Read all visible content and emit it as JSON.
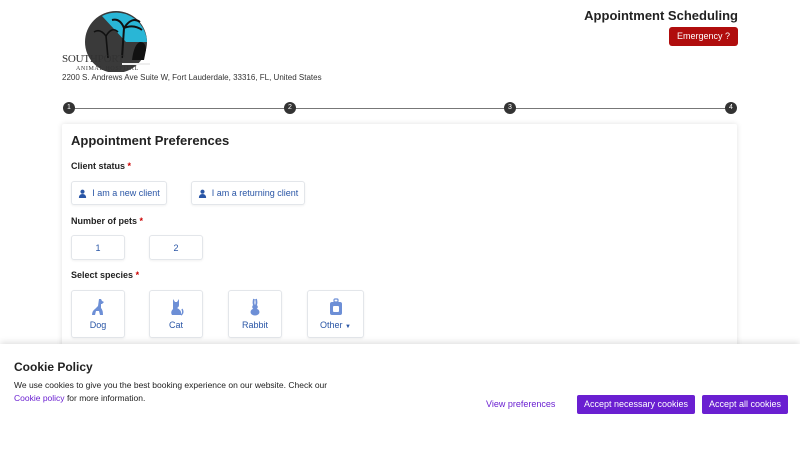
{
  "header": {
    "logo_line1": "SOUTHPORT",
    "logo_line2": "ANIMAL HOSPITAL",
    "address": "2200 S. Andrews Ave Suite W, Fort Lauderdale, 33316, FL, United States",
    "title": "Appointment Scheduling",
    "emergency_label": "Emergency ?"
  },
  "stepper": {
    "steps": [
      "1",
      "2",
      "3",
      "4"
    ],
    "current": 1
  },
  "form": {
    "title": "Appointment Preferences",
    "client_status": {
      "label": "Client status",
      "required_mark": "*",
      "options": [
        "I am a new client",
        "I am a returning client"
      ]
    },
    "pets": {
      "label": "Number of pets",
      "required_mark": "*",
      "options": [
        "1",
        "2"
      ]
    },
    "species": {
      "label": "Select species",
      "required_mark": "*",
      "options": [
        "Dog",
        "Cat",
        "Rabbit",
        "Other"
      ]
    }
  },
  "cookie": {
    "title": "Cookie Policy",
    "text": "We use cookies to give you the best booking experience on our website. Check our",
    "link": "Cookie policy",
    "text_after": "for more information.",
    "view_prefs": "View preferences",
    "accept_necessary": "Accept necessary cookies",
    "accept_all": "Accept all cookies"
  },
  "colors": {
    "emergency": "#b00d0d",
    "accent": "#6a1fd1",
    "option_text": "#2a56a6",
    "logo_sky": "#29b6d6"
  },
  "icons": {
    "client_option": "user-icon",
    "dog": "dog-icon",
    "cat": "cat-icon",
    "rabbit": "rabbit-icon",
    "other": "pet-carrier-icon",
    "dropdown": "caret-down-icon"
  }
}
